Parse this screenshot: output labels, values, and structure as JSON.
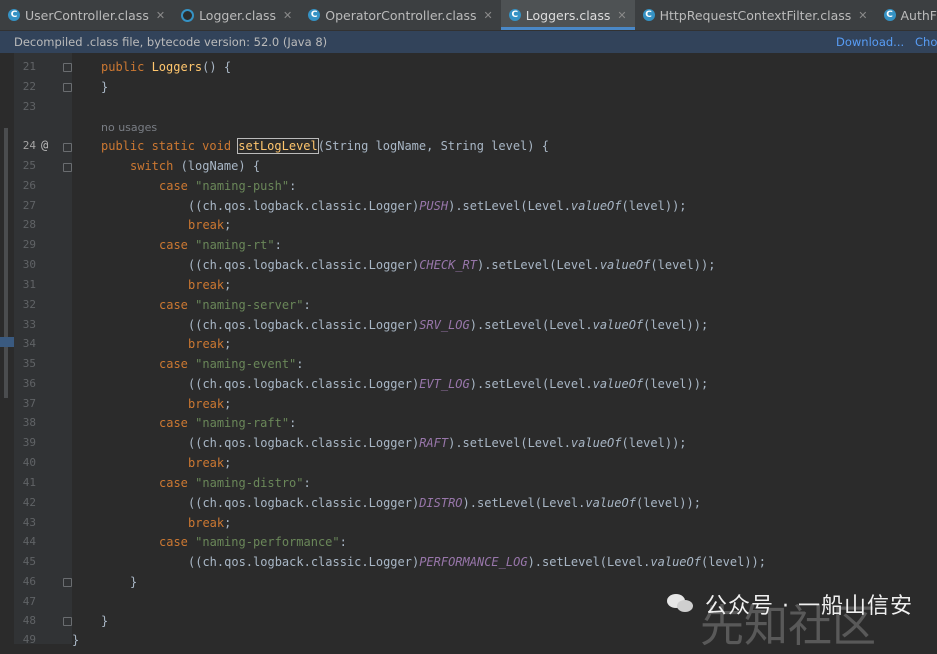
{
  "tabs": [
    {
      "label": "UserController.class",
      "icon": "class-icon",
      "active": false
    },
    {
      "label": "Logger.class",
      "icon": "interface-icon",
      "active": false
    },
    {
      "label": "OperatorController.class",
      "icon": "class-icon",
      "active": false
    },
    {
      "label": "Loggers.class",
      "icon": "class-icon",
      "active": true
    },
    {
      "label": "HttpRequestContextFilter.class",
      "icon": "class-icon",
      "active": false
    },
    {
      "label": "AuthFilter.class",
      "icon": "class-icon",
      "active": false
    }
  ],
  "infobar": {
    "message": "Decompiled .class file, bytecode version: 52.0 (Java 8)",
    "download_label": "Download...",
    "choose_label": "Cho"
  },
  "editor": {
    "usage_hint": "no usages",
    "line_numbers": [
      "21",
      "22",
      "23",
      "24",
      "25",
      "26",
      "27",
      "28",
      "29",
      "30",
      "31",
      "32",
      "33",
      "34",
      "35",
      "36",
      "37",
      "38",
      "39",
      "40",
      "41",
      "42",
      "43",
      "44",
      "45",
      "46",
      "47",
      "48",
      "49"
    ],
    "gutter_annotation": "@",
    "code": {
      "l21": "public Loggers() {",
      "l22": "}",
      "l24_mods": "public static void ",
      "l24_name": "setLogLevel",
      "l24_params": "(String logName, String level) {",
      "switch_kw": "switch",
      "switch_rest": " (logName) {",
      "case_kw": "case",
      "break_kw": "break",
      "cast_prefix": "((ch.qos.logback.classic.Logger)",
      "set_level": ").setLevel(Level.",
      "value_of": "valueOf",
      "tail": "(level));",
      "cases": [
        {
          "label": "\"naming-push\"",
          "field": "PUSH"
        },
        {
          "label": "\"naming-rt\"",
          "field": "CHECK_RT"
        },
        {
          "label": "\"naming-server\"",
          "field": "SRV_LOG"
        },
        {
          "label": "\"naming-event\"",
          "field": "EVT_LOG"
        },
        {
          "label": "\"naming-raft\"",
          "field": "RAFT"
        },
        {
          "label": "\"naming-distro\"",
          "field": "DISTRO"
        },
        {
          "label": "\"naming-performance\"",
          "field": "PERFORMANCE_LOG"
        }
      ],
      "close_brace": "}"
    }
  },
  "watermark": {
    "text": "公众号 · 一船山信安",
    "overlay": "先知社区"
  }
}
